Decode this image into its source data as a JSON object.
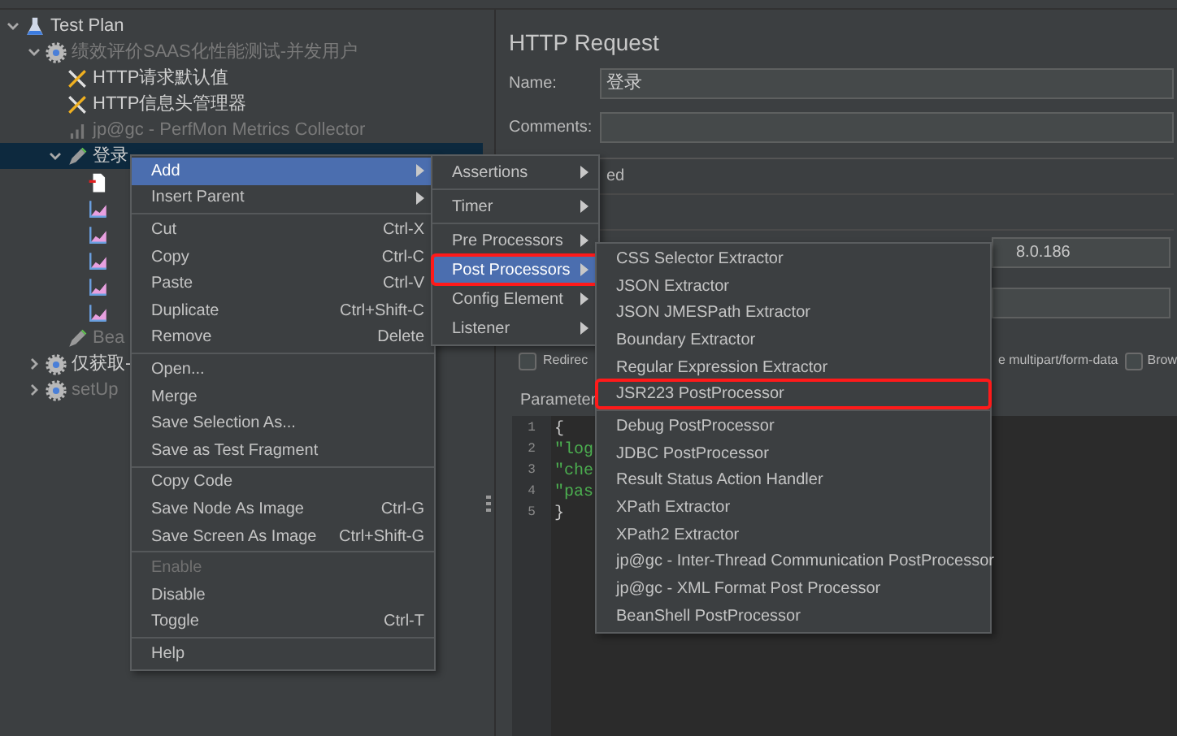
{
  "tree": [
    {
      "label": "Test Plan",
      "kind": "test-plan",
      "expanded": true,
      "disabled": false,
      "selected": false,
      "children": [
        {
          "label": "绩效评价SAAS化性能测试-并发用户",
          "kind": "thread-group",
          "expanded": true,
          "disabled": true,
          "selected": false,
          "children": [
            {
              "label": "HTTP请求默认值",
              "kind": "config",
              "disabled": false,
              "selected": false
            },
            {
              "label": "HTTP信息头管理器",
              "kind": "config",
              "disabled": false,
              "selected": false
            },
            {
              "label": "jp@gc - PerfMon Metrics Collector",
              "kind": "collector",
              "disabled": true,
              "selected": false
            },
            {
              "label": "登录",
              "kind": "sampler",
              "expanded": true,
              "disabled": false,
              "selected": true,
              "children": [
                {
                  "kind": "file",
                  "disabled": false,
                  "selected": false
                },
                {
                  "kind": "graph",
                  "disabled": false,
                  "selected": false
                },
                {
                  "kind": "graph",
                  "disabled": false,
                  "selected": false
                },
                {
                  "kind": "graph",
                  "disabled": false,
                  "selected": false
                },
                {
                  "kind": "graph",
                  "disabled": false,
                  "selected": false
                },
                {
                  "kind": "graph",
                  "disabled": false,
                  "selected": false
                }
              ]
            },
            {
              "label": "Bea",
              "kind": "sampler",
              "disabled": true,
              "selected": false
            }
          ]
        },
        {
          "label": "仅获取-",
          "kind": "thread-group",
          "expanded": false,
          "disabled": false,
          "selected": false
        },
        {
          "label": "setUp",
          "kind": "thread-group",
          "expanded": false,
          "disabled": true,
          "selected": false
        }
      ]
    }
  ],
  "form": {
    "title": "HTTP Request",
    "name_label": "Name:",
    "name_value": "登录",
    "comments_label": "Comments:",
    "section_fragment": "ed",
    "server_fragment": "8.0.186",
    "redirect_label": "Redirec",
    "redirect_checked": false,
    "multipart_label": "e multipart/form-data",
    "browser_label": "Brow",
    "browser_checked": false,
    "parameters_label": "Parameter",
    "code_lines": [
      {
        "number": "1",
        "text": "{",
        "kind": "brace"
      },
      {
        "number": "2",
        "text": "\"log",
        "kind": "string"
      },
      {
        "number": "3",
        "text": "\"che",
        "kind": "string"
      },
      {
        "number": "4",
        "text": "\"pas",
        "kind": "string"
      },
      {
        "number": "5",
        "text": "}",
        "kind": "brace"
      }
    ]
  },
  "context_menu": {
    "items": [
      {
        "kind": "item",
        "label": "Add",
        "has_submenu": true,
        "selected": true,
        "disabled": false
      },
      {
        "kind": "item",
        "label": "Insert Parent",
        "has_submenu": true,
        "selected": false,
        "disabled": false
      },
      {
        "kind": "separator"
      },
      {
        "kind": "item",
        "label": "Cut",
        "shortcut": "Ctrl-X",
        "selected": false,
        "disabled": false
      },
      {
        "kind": "item",
        "label": "Copy",
        "shortcut": "Ctrl-C",
        "selected": false,
        "disabled": false
      },
      {
        "kind": "item",
        "label": "Paste",
        "shortcut": "Ctrl-V",
        "selected": false,
        "disabled": false
      },
      {
        "kind": "item",
        "label": "Duplicate",
        "shortcut": "Ctrl+Shift-C",
        "selected": false,
        "disabled": false
      },
      {
        "kind": "item",
        "label": "Remove",
        "shortcut": "Delete",
        "selected": false,
        "disabled": false
      },
      {
        "kind": "separator"
      },
      {
        "kind": "item",
        "label": "Open...",
        "selected": false,
        "disabled": false
      },
      {
        "kind": "item",
        "label": "Merge",
        "selected": false,
        "disabled": false
      },
      {
        "kind": "item",
        "label": "Save Selection As...",
        "selected": false,
        "disabled": false
      },
      {
        "kind": "item",
        "label": "Save as Test Fragment",
        "selected": false,
        "disabled": false
      },
      {
        "kind": "separator"
      },
      {
        "kind": "item",
        "label": "Copy Code",
        "selected": false,
        "disabled": false
      },
      {
        "kind": "item",
        "label": "Save Node As Image",
        "shortcut": "Ctrl-G",
        "selected": false,
        "disabled": false
      },
      {
        "kind": "item",
        "label": "Save Screen As Image",
        "shortcut": "Ctrl+Shift-G",
        "selected": false,
        "disabled": false
      },
      {
        "kind": "separator"
      },
      {
        "kind": "item",
        "label": "Enable",
        "selected": false,
        "disabled": true
      },
      {
        "kind": "item",
        "label": "Disable",
        "selected": false,
        "disabled": false
      },
      {
        "kind": "item",
        "label": "Toggle",
        "shortcut": "Ctrl-T",
        "selected": false,
        "disabled": false
      },
      {
        "kind": "separator"
      },
      {
        "kind": "item",
        "label": "Help",
        "selected": false,
        "disabled": false
      }
    ]
  },
  "add_menu": {
    "items": [
      {
        "kind": "item",
        "label": "Assertions",
        "has_submenu": true,
        "selected": false,
        "annotated": false
      },
      {
        "kind": "separator"
      },
      {
        "kind": "item",
        "label": "Timer",
        "has_submenu": true,
        "selected": false,
        "annotated": false
      },
      {
        "kind": "separator"
      },
      {
        "kind": "item",
        "label": "Pre Processors",
        "has_submenu": true,
        "selected": false,
        "annotated": false
      },
      {
        "kind": "item",
        "label": "Post Processors",
        "has_submenu": true,
        "selected": true,
        "annotated": true
      },
      {
        "kind": "item",
        "label": "Config Element",
        "has_submenu": true,
        "selected": false,
        "annotated": false
      },
      {
        "kind": "item",
        "label": "Listener",
        "has_submenu": true,
        "selected": false,
        "annotated": false
      }
    ]
  },
  "post_processors_menu": {
    "items": [
      {
        "kind": "item",
        "label": "CSS Selector Extractor",
        "annotated": false
      },
      {
        "kind": "item",
        "label": "JSON Extractor",
        "annotated": false
      },
      {
        "kind": "item",
        "label": "JSON JMESPath Extractor",
        "annotated": false
      },
      {
        "kind": "item",
        "label": "Boundary Extractor",
        "annotated": false
      },
      {
        "kind": "item",
        "label": "Regular Expression Extractor",
        "annotated": false
      },
      {
        "kind": "item",
        "label": "JSR223 PostProcessor",
        "annotated": true
      },
      {
        "kind": "separator"
      },
      {
        "kind": "item",
        "label": "Debug PostProcessor",
        "annotated": false
      },
      {
        "kind": "item",
        "label": "JDBC PostProcessor",
        "annotated": false
      },
      {
        "kind": "item",
        "label": "Result Status Action Handler",
        "annotated": false
      },
      {
        "kind": "item",
        "label": "XPath Extractor",
        "annotated": false
      },
      {
        "kind": "item",
        "label": "XPath2 Extractor",
        "annotated": false
      },
      {
        "kind": "item",
        "label": "jp@gc - Inter-Thread Communication PostProcessor",
        "annotated": false
      },
      {
        "kind": "item",
        "label": "jp@gc - XML Format Post Processor",
        "annotated": false
      },
      {
        "kind": "item",
        "label": "BeanShell PostProcessor",
        "annotated": false
      }
    ]
  }
}
